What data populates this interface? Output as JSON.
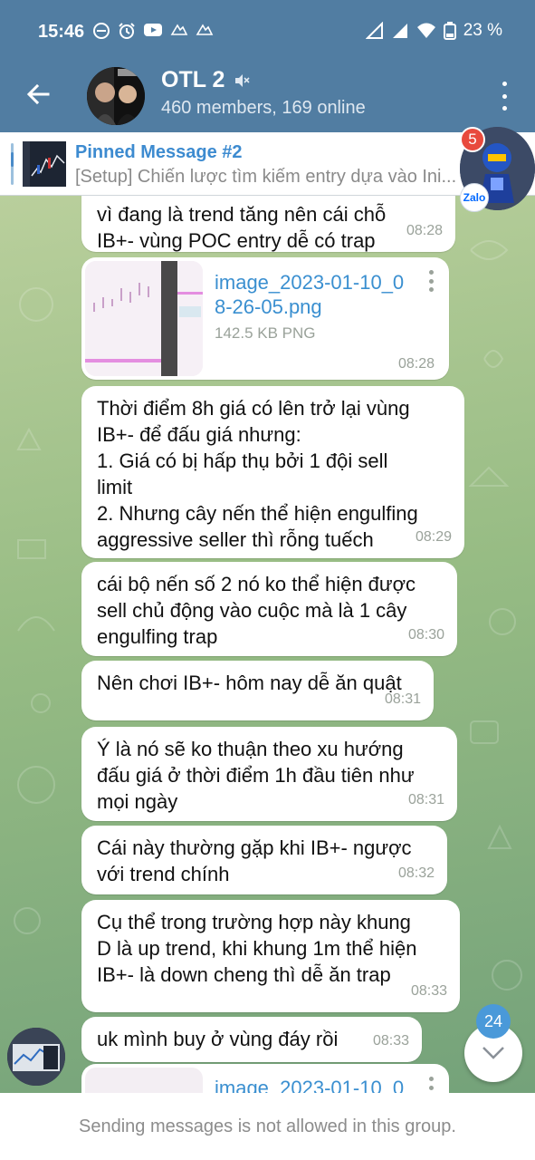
{
  "status_bar": {
    "time": "15:46",
    "battery": "23 %",
    "icons": [
      "do-not-disturb-icon",
      "alarm-icon",
      "youtube-icon",
      "app-icon",
      "app-icon"
    ]
  },
  "header": {
    "title": "OTL 2",
    "subtitle": "460 members, 169 online",
    "muted_icon": "muted-speaker-icon"
  },
  "pinned": {
    "title": "Pinned Message #2",
    "text": "[Setup] Chiến lược tìm kiếm entry dựa vào Ini..."
  },
  "floating_widget": {
    "badge": "5",
    "label": "Zalo"
  },
  "messages": [
    {
      "text": "vì đang là trend tăng nên cái chỗ\nIB+- vùng POC entry dễ có trap",
      "time": "08:28"
    },
    {
      "text": "Thời điểm 8h giá có lên trở lại vùng\nIB+- để đấu giá nhưng:\n1. Giá có bị hấp thụ bởi 1 đội sell\nlimit\n2. Nhưng cây nến thể hiện engulfing\naggressive seller thì rỗng tuếch",
      "time": "08:29"
    },
    {
      "text": "cái bộ nến số 2 nó ko thể hiện được\nsell chủ động vào cuộc mà là 1 cây\nengulfing trap",
      "time": "08:30"
    },
    {
      "text": "Nên chơi IB+- hôm nay dễ ăn quật",
      "time": "08:31"
    },
    {
      "text": "Ý là nó sẽ ko thuận theo xu hướng\nđấu giá ở thời điểm 1h đầu tiên như\nmọi ngày",
      "time": "08:31"
    },
    {
      "text": "Cái này thường gặp khi IB+- ngược\nvới trend chính",
      "time": "08:32"
    },
    {
      "text": "Cụ thể trong trường hợp này khung\nD là up trend, khi khung 1m thể hiện\nIB+- là down cheng thì dễ ăn trap",
      "time": "08:33"
    },
    {
      "text": "uk mình buy ở vùng đáy rồi",
      "time": "08:33"
    }
  ],
  "file": {
    "name": "image_2023-01-10_08-26-05.png",
    "size": "142.5 KB PNG",
    "time": "08:28"
  },
  "file_partial": {
    "name": "image_2023-01-10_0"
  },
  "scroll_fab": {
    "badge": "24"
  },
  "footer": {
    "notice": "Sending messages is not allowed in this group."
  },
  "colors": {
    "header": "#517da2",
    "accent": "#3d8bd0",
    "bubble": "#ffffff",
    "badge_red": "#e84a3d",
    "badge_blue": "#4a99d9"
  }
}
